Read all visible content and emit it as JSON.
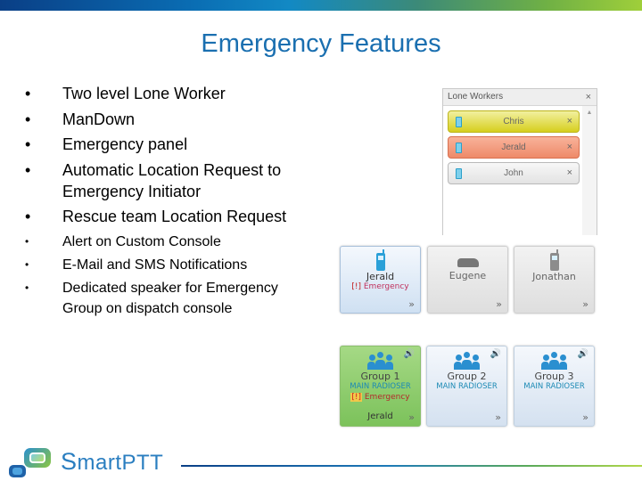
{
  "slide": {
    "title": "Emergency Features",
    "bullets_primary": [
      "Two level Lone Worker",
      "ManDown",
      "Emergency panel",
      "Automatic Location Request to Emergency Initiator",
      "Rescue team Location Request"
    ],
    "bullets_secondary": [
      "Alert on Custom Console",
      "E-Mail and SMS Notifications",
      "Dedicated speaker for Emergency Group on dispatch console"
    ],
    "bullet_glyph": "•"
  },
  "lone_workers": {
    "title": "Lone Workers",
    "close_glyph": "×",
    "scroll_up_glyph": "▲",
    "items": [
      {
        "name": "Chris",
        "state": "warning",
        "color": "#d6cf1e"
      },
      {
        "name": "Jerald",
        "state": "alarm",
        "color": "#ee8a69"
      },
      {
        "name": "John",
        "state": "normal",
        "color": "#e3e3e3"
      }
    ],
    "remove_glyph": "×"
  },
  "subscribers": [
    {
      "name": "Jerald",
      "icon": "phone-icon",
      "status": "Emergency",
      "status_prefix": "[!]",
      "active": true
    },
    {
      "name": "Eugene",
      "icon": "car-icon",
      "status": "",
      "active": false
    },
    {
      "name": "Jonathan",
      "icon": "phone-icon",
      "status": "",
      "active": false
    }
  ],
  "groups": [
    {
      "name": "Group 1",
      "server": "MAIN RADIOSER",
      "status": "Emergency",
      "status_prefix": "[!]",
      "initiator": "Jerald",
      "color": "#7cc25b"
    },
    {
      "name": "Group 2",
      "server": "MAIN RADIOSER"
    },
    {
      "name": "Group 3",
      "server": "MAIN RADIOSER"
    }
  ],
  "tile_more_glyph": "»",
  "speaker_glyph": "🔊",
  "footer": {
    "brand_cap": "S",
    "brand_rest": "martPTT"
  },
  "colors": {
    "title": "#1a6fb0",
    "accent_blue": "#2a8fd0",
    "emergency_red": "#c0305c"
  }
}
